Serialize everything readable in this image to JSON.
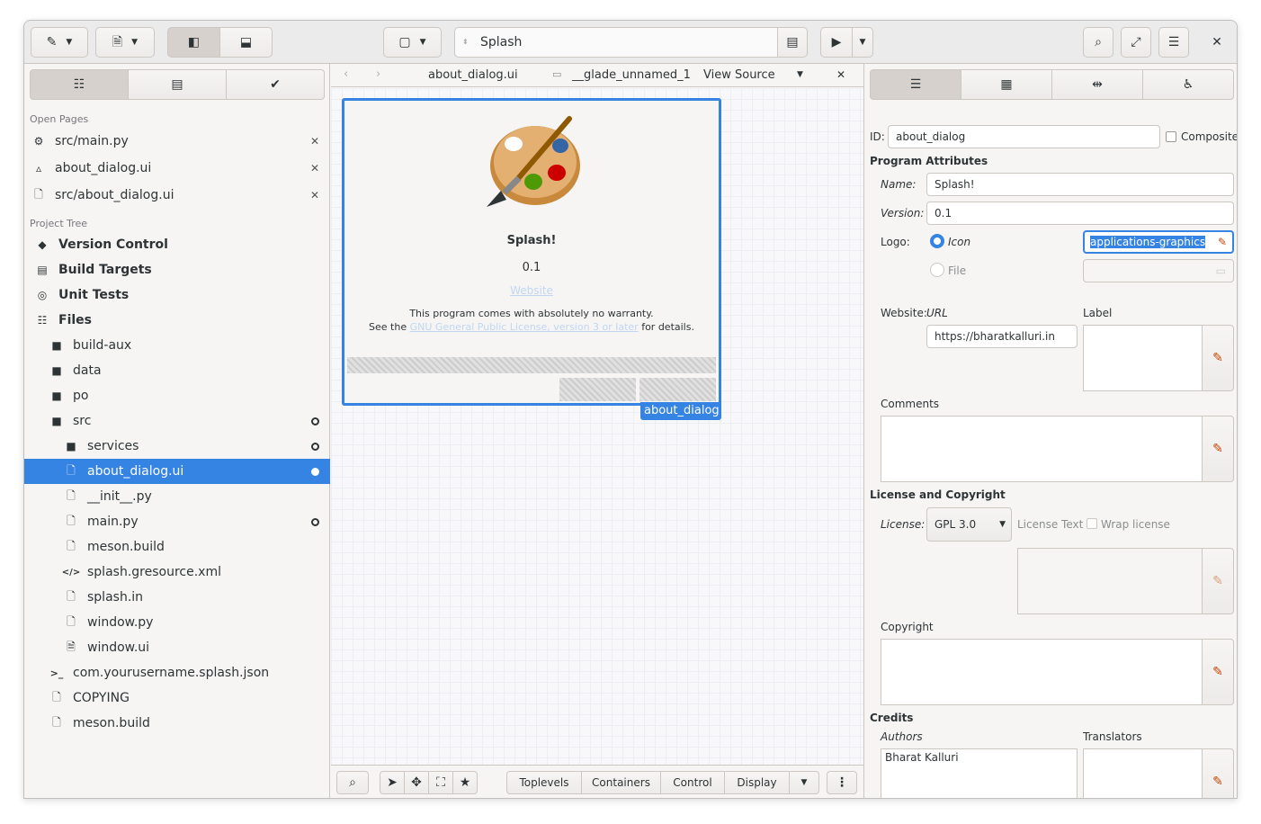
{
  "header": {
    "project_name": "Splash"
  },
  "left": {
    "open_pages_label": "Open Pages",
    "open_pages": [
      {
        "label": "src/main.py",
        "icon": "python-icon"
      },
      {
        "label": "about_dialog.ui",
        "icon": "glade-icon"
      },
      {
        "label": "src/about_dialog.ui",
        "icon": "text-file-icon"
      }
    ],
    "project_tree_label": "Project Tree",
    "top_items": [
      {
        "label": "Version Control",
        "icon": "git-icon"
      },
      {
        "label": "Build Targets",
        "icon": "build-icon"
      },
      {
        "label": "Unit Tests",
        "icon": "unit-tests-icon"
      },
      {
        "label": "Files",
        "icon": "files-icon"
      }
    ],
    "files": [
      {
        "label": "build-aux"
      },
      {
        "label": "data"
      },
      {
        "label": "po"
      },
      {
        "label": "src"
      },
      {
        "label": "services"
      },
      {
        "label": "about_dialog.ui"
      },
      {
        "label": "__init__.py"
      },
      {
        "label": "main.py"
      },
      {
        "label": "meson.build"
      },
      {
        "label": "splash.gresource.xml"
      },
      {
        "label": "splash.in"
      },
      {
        "label": "window.py"
      },
      {
        "label": "window.ui"
      },
      {
        "label": "com.yourusername.splash.json"
      },
      {
        "label": "COPYING"
      },
      {
        "label": "meson.build"
      }
    ]
  },
  "center": {
    "tab_file": "about_dialog.ui",
    "tab_object": "__glade_unnamed_1",
    "view_source": "View Source",
    "dialog": {
      "name": "Splash!",
      "version": "0.1",
      "website": "Website",
      "warranty_line1": "This program comes with absolutely no warranty.",
      "warranty_see": "See the",
      "warranty_link": "GNU General Public License, version 3 or later",
      "warranty_end": "for details.",
      "widget_label": "about_dialog"
    },
    "palette": {
      "toplevels": "Toplevels",
      "containers": "Containers",
      "control": "Control",
      "display": "Display"
    }
  },
  "right": {
    "id_label": "ID:",
    "id_value": "about_dialog",
    "composite_label": "Composite",
    "program_attributes": "Program Attributes",
    "name_label": "Name:",
    "name_value": "Splash!",
    "version_label": "Version:",
    "version_value": "0.1",
    "logo_label": "Logo:",
    "icon_option": "Icon",
    "file_option": "File",
    "icon_value": "applications-graphics",
    "website_label": "Website:",
    "url_label": "URL",
    "url_value": "https://bharatkalluri.in",
    "label_label": "Label",
    "comments_label": "Comments",
    "license_section": "License and Copyright",
    "license_label": "License:",
    "license_value": "GPL 3.0",
    "license_text_label": "License Text",
    "wrap_license_label": "Wrap license",
    "copyright_label": "Copyright",
    "credits_label": "Credits",
    "authors_label": "Authors",
    "authors_value": "Bharat Kalluri",
    "translators_label": "Translators"
  },
  "colors": {
    "accent": "#3584e4"
  }
}
